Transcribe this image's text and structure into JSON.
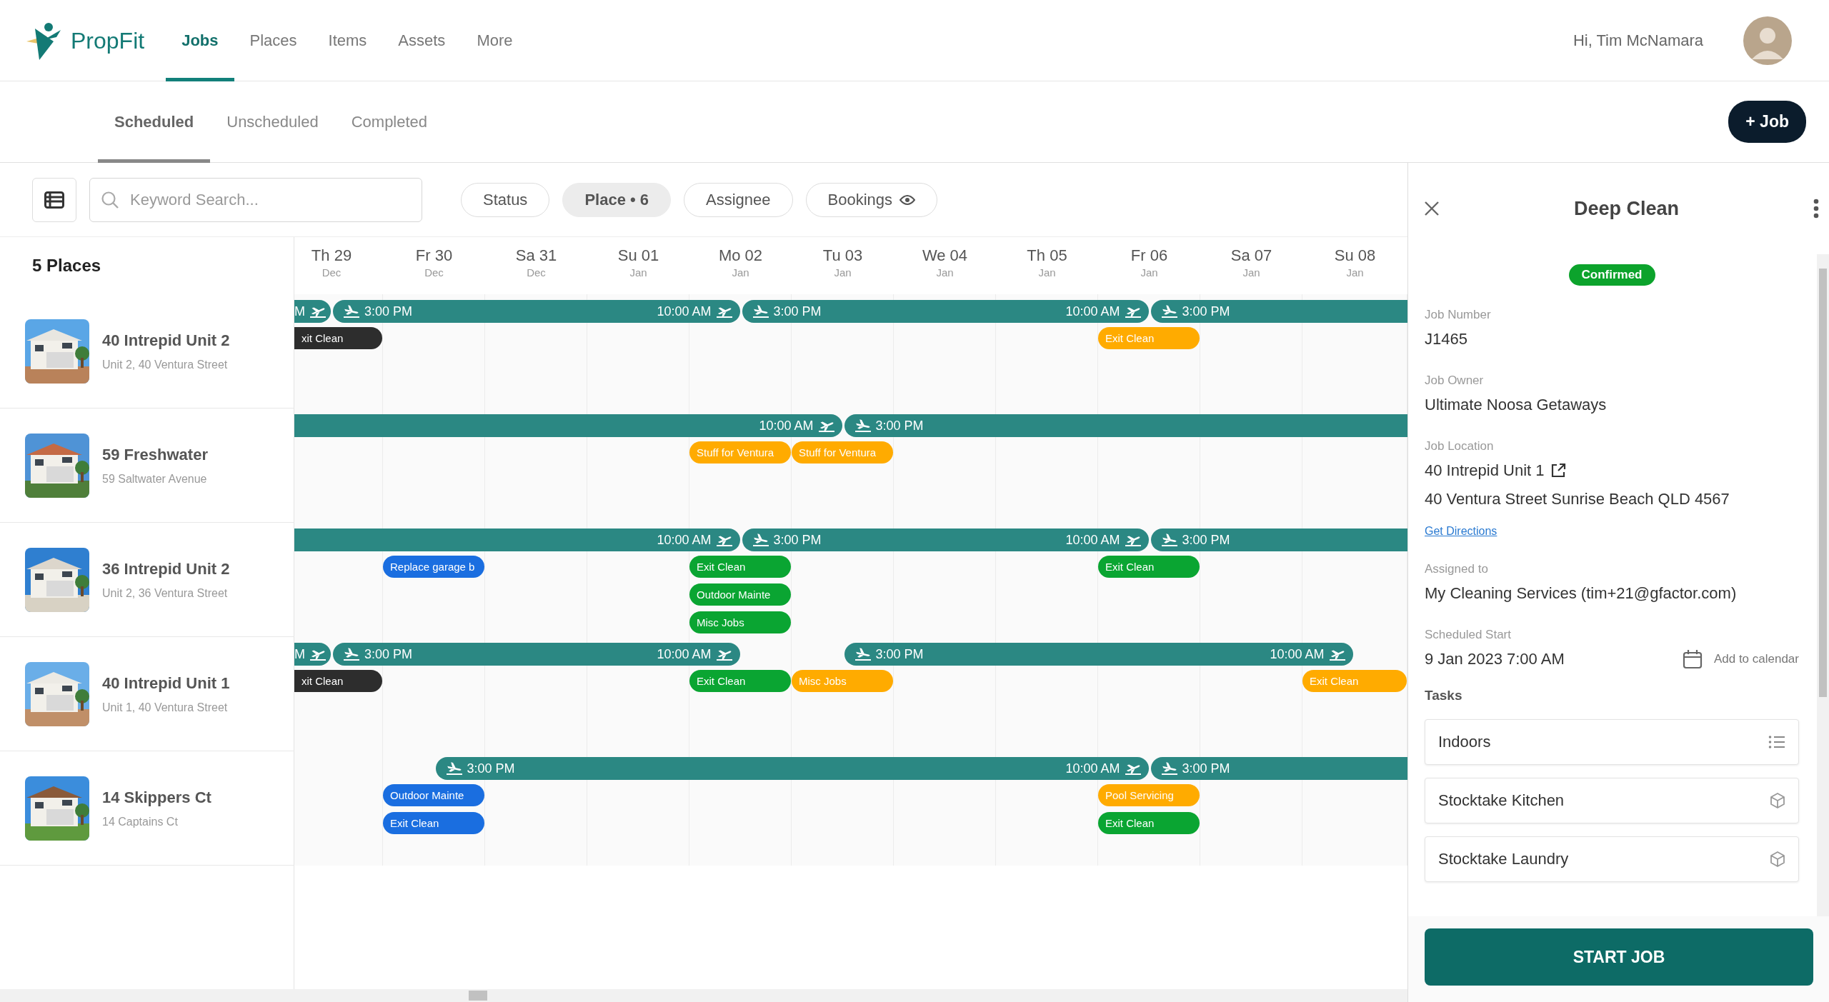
{
  "app": {
    "name": "PropFit"
  },
  "nav": [
    {
      "label": "Jobs",
      "selected": true
    },
    {
      "label": "Places",
      "selected": false
    },
    {
      "label": "Items",
      "selected": false
    },
    {
      "label": "Assets",
      "selected": false
    },
    {
      "label": "More",
      "selected": false
    }
  ],
  "user": {
    "greeting": "Hi, Tim McNamara"
  },
  "subtabs": [
    {
      "label": "Scheduled",
      "selected": true
    },
    {
      "label": "Unscheduled",
      "selected": false
    },
    {
      "label": "Completed",
      "selected": false
    }
  ],
  "new_job_button": "+ Job",
  "search": {
    "placeholder": "Keyword Search..."
  },
  "filters": [
    {
      "label": "Status",
      "active": false,
      "kind": "filter"
    },
    {
      "label": "Place • 6",
      "active": true,
      "kind": "filter"
    },
    {
      "label": "Assignee",
      "active": false,
      "kind": "filter"
    },
    {
      "label": "Bookings",
      "active": false,
      "kind": "visibility"
    }
  ],
  "places_count": "5 Places",
  "days": [
    {
      "day": "Th 29",
      "month": "Dec"
    },
    {
      "day": "Fr 30",
      "month": "Dec"
    },
    {
      "day": "Sa 31",
      "month": "Dec"
    },
    {
      "day": "Su 01",
      "month": "Jan"
    },
    {
      "day": "Mo 02",
      "month": "Jan"
    },
    {
      "day": "Tu 03",
      "month": "Jan"
    },
    {
      "day": "We 04",
      "month": "Jan"
    },
    {
      "day": "Th 05",
      "month": "Jan"
    },
    {
      "day": "Fr 06",
      "month": "Jan"
    },
    {
      "day": "Sa 07",
      "month": "Jan"
    },
    {
      "day": "Su 08",
      "month": "Jan"
    }
  ],
  "places": [
    {
      "name": "40 Intrepid Unit 2",
      "address": "Unit 2, 40 Ventura Street",
      "booked_at_start": true,
      "cells": [
        {
          "check_out": "M",
          "check_in": "3:00 PM",
          "events": [
            {
              "title": "xit Clean",
              "color": "#2d2d2d"
            }
          ]
        },
        {},
        {},
        {},
        {
          "check_out": "10:00 AM",
          "check_in": "3:00 PM"
        },
        {},
        {},
        {},
        {
          "check_out": "10:00 AM",
          "check_in": "3:00 PM",
          "events": [
            {
              "title": "Exit Clean",
              "color": "#ffab00"
            }
          ]
        },
        {},
        {}
      ]
    },
    {
      "name": "59 Freshwater",
      "address": "59 Saltwater Avenue",
      "booked_at_start": true,
      "cells": [
        {},
        {},
        {},
        {},
        {
          "events": [
            {
              "title": "Stuff for Ventura",
              "color": "#ffab00"
            }
          ]
        },
        {
          "check_out": "10:00 AM",
          "check_in": "3:00 PM",
          "events": [
            {
              "title": "Stuff for Ventura",
              "color": "#ffab00"
            }
          ]
        },
        {},
        {},
        {},
        {},
        {}
      ]
    },
    {
      "name": "36 Intrepid Unit 2",
      "address": "Unit 2, 36 Ventura Street",
      "booked_at_start": true,
      "cells": [
        {},
        {
          "events": [
            {
              "title": "Replace garage b",
              "color": "#1a6ee0"
            }
          ]
        },
        {},
        {},
        {
          "check_out": "10:00 AM",
          "check_in": "3:00 PM",
          "events": [
            {
              "title": "Exit Clean",
              "color": "#0aa532"
            },
            {
              "title": "Outdoor Mainte",
              "color": "#0aa532"
            },
            {
              "title": "Misc Jobs",
              "color": "#0aa532"
            }
          ]
        },
        {},
        {},
        {},
        {
          "check_out": "10:00 AM",
          "check_in": "3:00 PM",
          "events": [
            {
              "title": "Exit Clean",
              "color": "#0aa532"
            }
          ]
        },
        {},
        {}
      ]
    },
    {
      "name": "40 Intrepid Unit 1",
      "address": "Unit 1, 40 Ventura Street",
      "booked_at_start": true,
      "cells": [
        {
          "check_out": "M",
          "check_in": "3:00 PM",
          "events": [
            {
              "title": "xit Clean",
              "color": "#2d2d2d"
            }
          ]
        },
        {},
        {},
        {},
        {
          "check_out": "10:00 AM",
          "events": [
            {
              "title": "Exit Clean",
              "color": "#0aa532"
            }
          ]
        },
        {
          "check_in": "3:00 PM",
          "events": [
            {
              "title": "Misc Jobs",
              "color": "#ffab00"
            }
          ]
        },
        {},
        {},
        {},
        {},
        {
          "check_out": "10:00 AM",
          "events": [
            {
              "title": "Exit Clean",
              "color": "#ffab00"
            }
          ]
        }
      ]
    },
    {
      "name": "14 Skippers Ct",
      "address": "14 Captains Ct",
      "booked_at_start": false,
      "cells": [
        {},
        {
          "check_in": "3:00 PM",
          "events": [
            {
              "title": "Outdoor Mainte",
              "color": "#1a6ee0"
            },
            {
              "title": "Exit Clean",
              "color": "#1a6ee0"
            }
          ]
        },
        {},
        {},
        {},
        {},
        {},
        {},
        {
          "check_out": "10:00 AM",
          "check_in": "3:00 PM",
          "events": [
            {
              "title": "Pool Servicing",
              "color": "#ffab00"
            },
            {
              "title": "Exit Clean",
              "color": "#0aa532"
            }
          ]
        },
        {},
        {}
      ]
    }
  ],
  "job": {
    "title": "Deep Clean",
    "status": "Confirmed",
    "fields": [
      {
        "label": "Job Number",
        "value": "J1465"
      },
      {
        "label": "Job Owner",
        "value": "Ultimate Noosa Getaways"
      }
    ],
    "location": {
      "label": "Job Location",
      "name": "40 Intrepid Unit 1",
      "address": "40 Ventura Street Sunrise Beach QLD 4567",
      "directions": "Get Directions"
    },
    "assigned": {
      "label": "Assigned to",
      "value": "My Cleaning Services (tim+21@gfactor.com)"
    },
    "scheduled": {
      "label": "Scheduled Start",
      "value": "9 Jan 2023 7:00 AM",
      "action": "Add to calendar"
    },
    "tasks_heading": "Tasks",
    "tasks": [
      {
        "name": "Indoors",
        "kind": "checklist"
      },
      {
        "name": "Stocktake Kitchen",
        "kind": "stocktake"
      },
      {
        "name": "Stocktake Laundry",
        "kind": "stocktake"
      }
    ],
    "start_button": "START JOB"
  }
}
